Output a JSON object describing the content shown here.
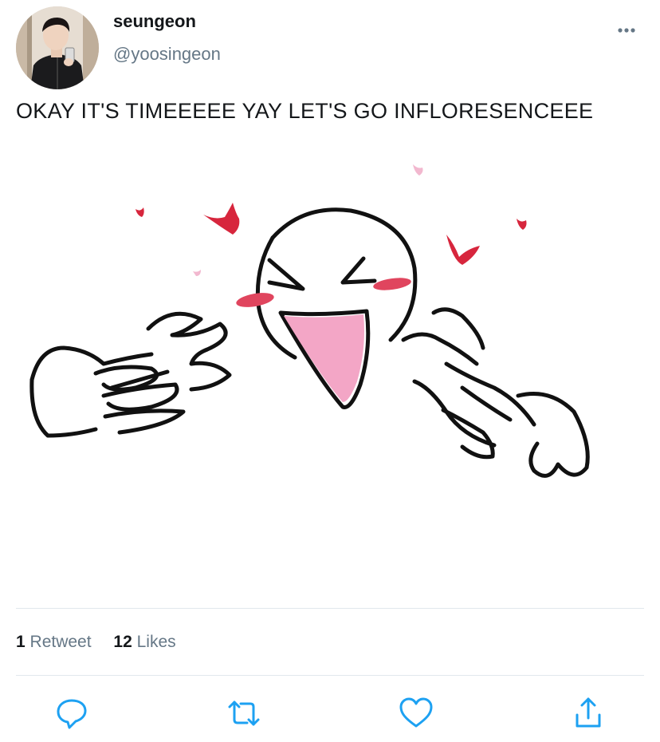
{
  "tweet": {
    "display_name": "seungeon",
    "handle": "@yoosingeon",
    "text": "OKAY IT'S TIMEEEEE YAY LET'S GO INFLORESENCEEE"
  },
  "stats": {
    "retweets_count": "1",
    "retweets_label": "Retweet",
    "likes_count": "12",
    "likes_label": "Likes"
  },
  "icons": {
    "more": "more-dots-icon",
    "reply": "reply-icon",
    "retweet": "retweet-icon",
    "like": "heart-icon",
    "share": "share-icon"
  },
  "colors": {
    "accent_blue": "#1da1f2",
    "handle_gray": "#657786",
    "heart_red": "#d7263d",
    "blush_pink": "#f2a7c3"
  }
}
